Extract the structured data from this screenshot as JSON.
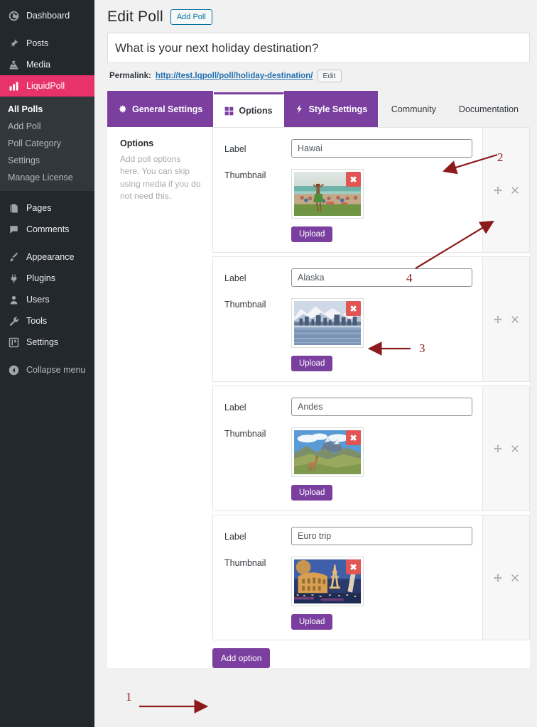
{
  "sidebar": {
    "items": [
      {
        "label": "Dashboard",
        "icon": "dashboard-icon",
        "current": false
      },
      {
        "label": "Posts",
        "icon": "pin-icon",
        "current": false
      },
      {
        "label": "Media",
        "icon": "media-icon",
        "current": false
      },
      {
        "label": "LiquidPoll",
        "icon": "chart-bar-icon",
        "current": true
      },
      {
        "label": "Pages",
        "icon": "pages-icon",
        "current": false
      },
      {
        "label": "Comments",
        "icon": "comment-icon",
        "current": false
      },
      {
        "label": "Appearance",
        "icon": "brush-icon",
        "current": false
      },
      {
        "label": "Plugins",
        "icon": "plug-icon",
        "current": false
      },
      {
        "label": "Users",
        "icon": "user-icon",
        "current": false
      },
      {
        "label": "Tools",
        "icon": "wrench-icon",
        "current": false
      },
      {
        "label": "Settings",
        "icon": "sliders-icon",
        "current": false
      },
      {
        "label": "Collapse menu",
        "icon": "collapse-icon",
        "current": false
      }
    ],
    "submenu": [
      {
        "label": "All Polls",
        "current": true
      },
      {
        "label": "Add Poll",
        "current": false
      },
      {
        "label": "Poll Category",
        "current": false
      },
      {
        "label": "Settings",
        "current": false
      },
      {
        "label": "Manage License",
        "current": false
      }
    ],
    "colors": {
      "background": "#23282d",
      "submenu_background": "#32373c",
      "highlight": "#e8326a"
    }
  },
  "header": {
    "title": "Edit Poll",
    "add_poll_label": "Add Poll",
    "poll_title_value": "What is your next holiday destination?",
    "poll_title_placeholder": "Add title",
    "permalink_label": "Permalink:",
    "permalink_url": "http://test.lqpoll/poll/holiday-destination/",
    "permalink_edit_label": "Edit"
  },
  "tabs": [
    {
      "label": "General Settings",
      "icon": "gear-icon",
      "active": false,
      "type": "tab"
    },
    {
      "label": "Options",
      "icon": "grid-icon",
      "active": true,
      "type": "tab"
    },
    {
      "label": "Style Settings",
      "icon": "bolt-icon",
      "active": false,
      "type": "tab"
    },
    {
      "label": "Community",
      "icon": "",
      "active": false,
      "type": "link"
    },
    {
      "label": "Documentation",
      "icon": "",
      "active": false,
      "type": "link"
    }
  ],
  "panel": {
    "desc_title": "Options",
    "desc_text": "Add poll options here. You can skip using media if you do not need this.",
    "label_field_label": "Label",
    "thumbnail_field_label": "Thumbnail",
    "upload_label": "Upload",
    "remove_image_icon": "close-icon",
    "move_icon": "move-handle-icon",
    "delete_icon": "close-icon",
    "add_option_label": "Add option"
  },
  "options": [
    {
      "label_value": "Hawai",
      "thumbnail_alt": "hula-dancer-beach-photo"
    },
    {
      "label_value": "Alaska",
      "thumbnail_alt": "alaska-skyline-mountains-photo"
    },
    {
      "label_value": "Andes",
      "thumbnail_alt": "andes-llama-mountains-photo"
    },
    {
      "label_value": "Euro trip",
      "thumbnail_alt": "europe-landmarks-collage-photo"
    }
  ],
  "annotations": [
    {
      "number": "1",
      "target": "add-option-button"
    },
    {
      "number": "2",
      "target": "label-input-row-1"
    },
    {
      "number": "3",
      "target": "remove-image-row-2"
    },
    {
      "number": "4",
      "target": "row-tools-row-1"
    }
  ],
  "theme": {
    "accent_purple": "#7b3fa0",
    "annotation_red": "#8b1a1a",
    "remove_red": "#e15554"
  }
}
